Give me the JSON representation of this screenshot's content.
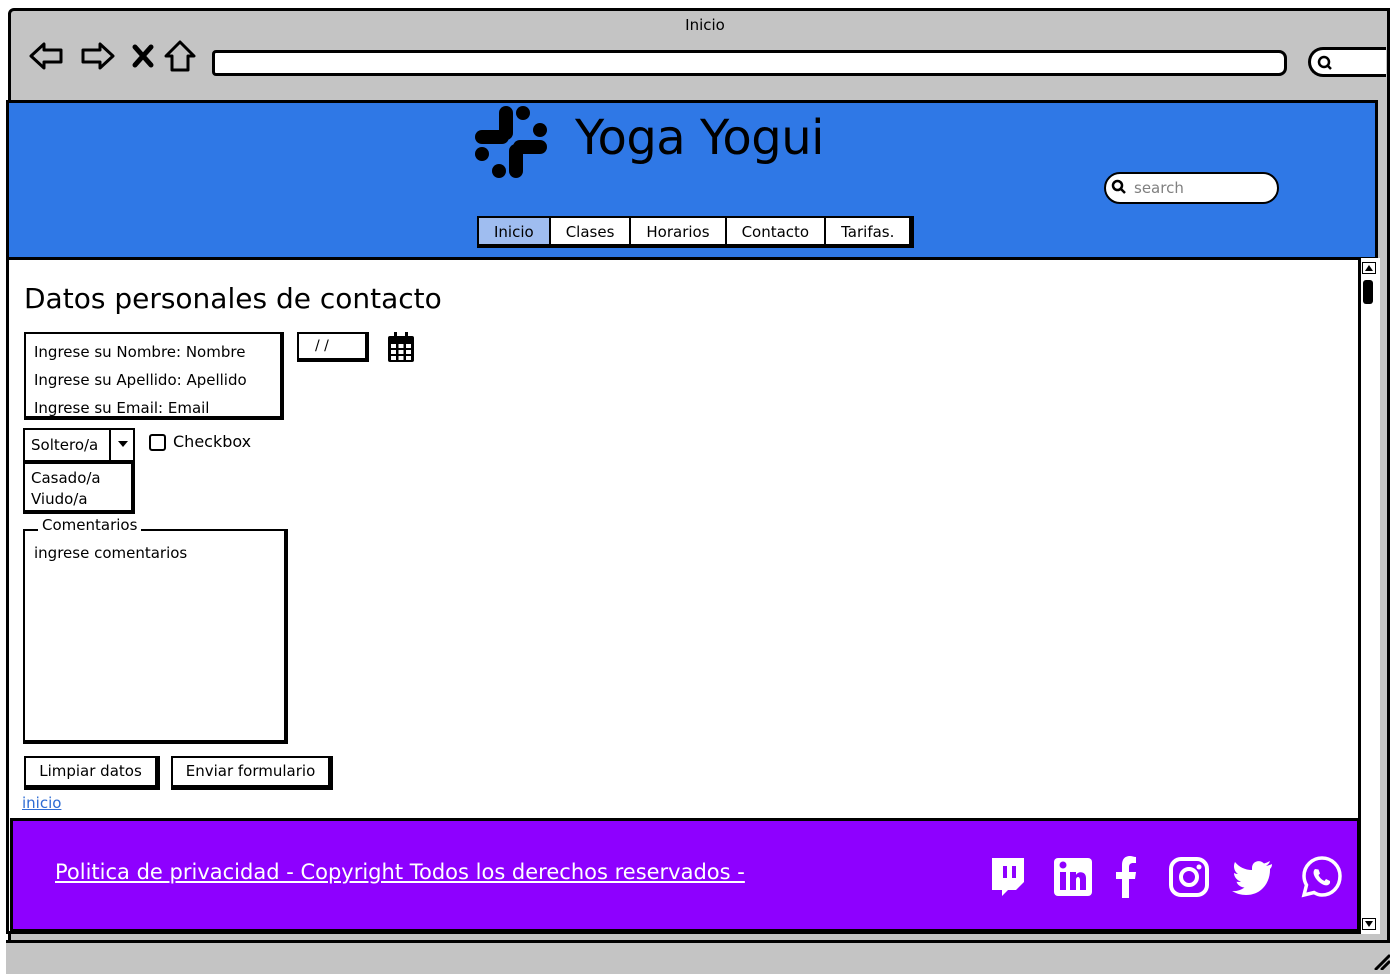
{
  "browser": {
    "tab_title": "Inicio",
    "address": "",
    "nav_icons": [
      "back-icon",
      "forward-icon",
      "stop-icon",
      "home-icon"
    ]
  },
  "header": {
    "brand": "Yoga Yogui",
    "search_placeholder": "search",
    "nav": [
      {
        "label": "Inicio",
        "active": true
      },
      {
        "label": "Clases",
        "active": false
      },
      {
        "label": "Horarios",
        "active": false
      },
      {
        "label": "Contacto",
        "active": false
      },
      {
        "label": "Tarifas.",
        "active": false
      }
    ],
    "color": "#2f78e6"
  },
  "form": {
    "title": "Datos personales de contacto",
    "fields": [
      "Ingrese su Nombre: Nombre",
      "Ingrese su Apellido: Apellido",
      "Ingrese su Email: Email"
    ],
    "date": "/ /",
    "marital_selected": "Soltero/a",
    "marital_options": [
      "Casado/a",
      "Viudo/a"
    ],
    "checkbox_label": "Checkbox",
    "comments_legend": "Comentarios",
    "comments_text": "ingrese comentarios",
    "clear_button": "Limpiar datos",
    "submit_button": "Enviar formulario",
    "home_link": "inicio"
  },
  "footer": {
    "text": "Politica de privacidad - Copyright Todos los derechos reservados -",
    "color": "#8e00ff",
    "social_icons": [
      "twitch-icon",
      "linkedin-icon",
      "facebook-icon",
      "instagram-icon",
      "twitter-icon",
      "whatsapp-icon"
    ]
  }
}
